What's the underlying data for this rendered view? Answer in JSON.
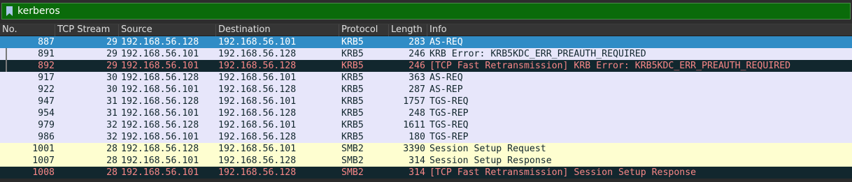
{
  "filter": {
    "value": "kerberos",
    "bookmark_icon": "bookmark-icon"
  },
  "colors": {
    "filter_valid_bg": "#0a6b0a",
    "selected_bg": "#308cc6",
    "kerberos_row_bg": "#e7e6fa",
    "smb_row_bg": "#fefed0",
    "bad_tcp_bg": "#12272e",
    "bad_tcp_fg": "#f78787"
  },
  "columns": {
    "no": "No.",
    "stream": "TCP Stream",
    "source": "Source",
    "destination": "Destination",
    "protocol": "Protocol",
    "length": "Length",
    "info": "Info"
  },
  "packets": [
    {
      "no": "887",
      "stream": "29",
      "source": "192.168.56.128",
      "destination": "192.168.56.101",
      "protocol": "KRB5",
      "length": "283",
      "info": "AS-REQ",
      "style": "selected"
    },
    {
      "no": "891",
      "stream": "29",
      "source": "192.168.56.101",
      "destination": "192.168.56.128",
      "protocol": "KRB5",
      "length": "246",
      "info": "KRB Error: KRB5KDC_ERR_PREAUTH_REQUIRED",
      "style": "kerb"
    },
    {
      "no": "892",
      "stream": "29",
      "source": "192.168.56.101",
      "destination": "192.168.56.128",
      "protocol": "KRB5",
      "length": "246",
      "info": "[TCP Fast Retransmission] KRB Error: KRB5KDC_ERR_PREAUTH_REQUIRED",
      "style": "bad"
    },
    {
      "no": "917",
      "stream": "30",
      "source": "192.168.56.128",
      "destination": "192.168.56.101",
      "protocol": "KRB5",
      "length": "363",
      "info": "AS-REQ",
      "style": "kerb"
    },
    {
      "no": "922",
      "stream": "30",
      "source": "192.168.56.101",
      "destination": "192.168.56.128",
      "protocol": "KRB5",
      "length": "287",
      "info": "AS-REP",
      "style": "kerb"
    },
    {
      "no": "947",
      "stream": "31",
      "source": "192.168.56.128",
      "destination": "192.168.56.101",
      "protocol": "KRB5",
      "length": "1757",
      "info": "TGS-REQ",
      "style": "kerb"
    },
    {
      "no": "954",
      "stream": "31",
      "source": "192.168.56.101",
      "destination": "192.168.56.128",
      "protocol": "KRB5",
      "length": "248",
      "info": "TGS-REP",
      "style": "kerb"
    },
    {
      "no": "979",
      "stream": "32",
      "source": "192.168.56.128",
      "destination": "192.168.56.101",
      "protocol": "KRB5",
      "length": "1611",
      "info": "TGS-REQ",
      "style": "kerb"
    },
    {
      "no": "986",
      "stream": "32",
      "source": "192.168.56.101",
      "destination": "192.168.56.128",
      "protocol": "KRB5",
      "length": "180",
      "info": "TGS-REP",
      "style": "kerb"
    },
    {
      "no": "1001",
      "stream": "28",
      "source": "192.168.56.128",
      "destination": "192.168.56.101",
      "protocol": "SMB2",
      "length": "3390",
      "info": "Session Setup Request",
      "style": "smb"
    },
    {
      "no": "1007",
      "stream": "28",
      "source": "192.168.56.101",
      "destination": "192.168.56.128",
      "protocol": "SMB2",
      "length": "314",
      "info": "Session Setup Response",
      "style": "smb"
    },
    {
      "no": "1008",
      "stream": "28",
      "source": "192.168.56.101",
      "destination": "192.168.56.128",
      "protocol": "SMB2",
      "length": "314",
      "info": "[TCP Fast Retransmission] Session Setup Response",
      "style": "bad"
    }
  ]
}
